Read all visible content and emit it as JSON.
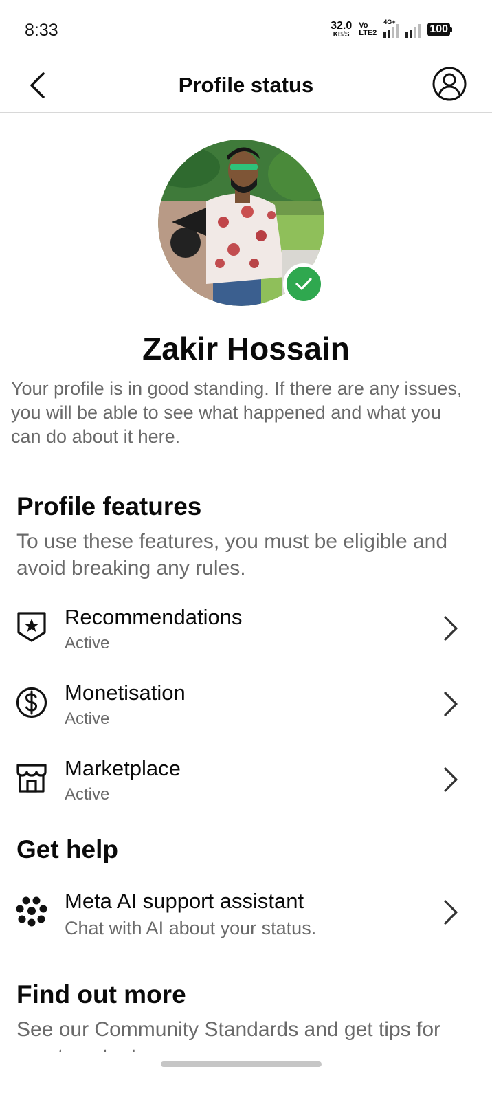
{
  "status_bar": {
    "time": "8:33",
    "net_speed": "32.0",
    "net_speed_unit": "KB/S",
    "volte_top": "Vo",
    "volte_bottom": "LTE2",
    "network_type": "4G+",
    "battery": "100"
  },
  "header": {
    "title": "Profile status",
    "back_icon": "chevron-left-icon",
    "account_icon": "user-circle-icon"
  },
  "profile": {
    "name": "Zakir Hossain",
    "verified_color": "#2fa84f",
    "standing_text": "Your profile is in good standing. If there are any issues, you will be able to see what happened and what you can do about it here."
  },
  "features_section": {
    "title": "Profile features",
    "description": "To use these features, you must be eligible and avoid breaking any rules.",
    "items": [
      {
        "label": "Recommendations",
        "status": "Active",
        "icon": "shield-star-icon"
      },
      {
        "label": "Monetisation",
        "status": "Active",
        "icon": "dollar-circle-icon"
      },
      {
        "label": "Marketplace",
        "status": "Active",
        "icon": "storefront-icon"
      }
    ]
  },
  "help_section": {
    "title": "Get help",
    "items": [
      {
        "label": "Meta AI support assistant",
        "subtitle": "Chat with AI about your status.",
        "icon": "meta-ai-icon"
      }
    ]
  },
  "more_section": {
    "title": "Find out more",
    "description": "See our Community Standards and get tips for great content"
  }
}
